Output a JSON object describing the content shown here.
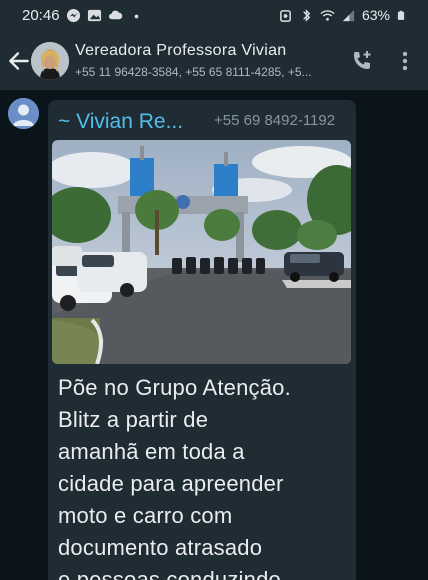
{
  "status_bar": {
    "time": "20:46",
    "battery": "63%"
  },
  "header": {
    "contact_name": "Vereadora Professora Vivian",
    "participants": "+55 11 96428-3584, +55 65 8111-4285, +5..."
  },
  "message": {
    "sender_name": "~ Vivian Re...",
    "sender_phone": "+55 69 8492-1192",
    "text_lines": [
      "Põe no Grupo Atenção.",
      "Blitz a partir de",
      "amanhã em toda a",
      "cidade para apreender",
      "moto e carro com",
      "documento atrasado",
      "e pessoas conduzindo"
    ]
  },
  "colors": {
    "header_bg": "#1f2c34",
    "chat_bg": "#0b141a",
    "bubble_bg": "#202c33",
    "sender_name": "#53bdeb"
  }
}
